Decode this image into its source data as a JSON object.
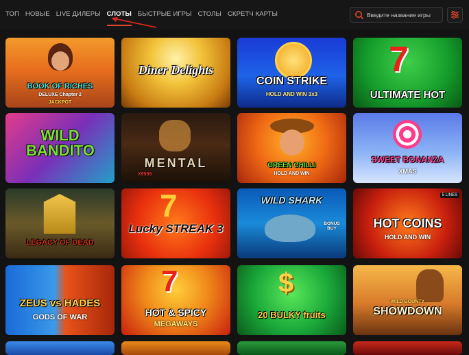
{
  "nav": {
    "tabs": [
      {
        "label": "ТОП"
      },
      {
        "label": "НОВЫЕ"
      },
      {
        "label": "LIVE ДИЛЕРЫ"
      },
      {
        "label": "СЛОТЫ"
      },
      {
        "label": "БЫСТРЫЕ ИГРЫ"
      },
      {
        "label": "СТОЛЫ"
      },
      {
        "label": "СКРЕТЧ КАРТЫ"
      }
    ],
    "active_tab": "СЛОТЫ"
  },
  "search": {
    "placeholder": "Введите название игры",
    "icon": "search-icon"
  },
  "filter": {
    "icon": "sliders-icon"
  },
  "accent": "#e8462a",
  "games": [
    {
      "title": "BOOK OF RICHES",
      "subtitle": "DELUXE Chapter 2",
      "extra": "JACKPOT"
    },
    {
      "title": "Diner Delights",
      "subtitle": ""
    },
    {
      "title": "COIN STRIKE",
      "subtitle": "HOLD AND WIN 3x3"
    },
    {
      "title": "ULTIMATE HOT",
      "subtitle": ""
    },
    {
      "title": "WILD BANDITO",
      "subtitle": ""
    },
    {
      "title": "MENTAL",
      "subtitle": "X9999"
    },
    {
      "title": "GREEN CHILLI",
      "subtitle": "HOLD AND WIN"
    },
    {
      "title": "SWEET BONANZA",
      "subtitle": "XMAS"
    },
    {
      "title": "LEGACY OF DEAD",
      "subtitle": ""
    },
    {
      "title": "Lucky STREAK 3",
      "subtitle": ""
    },
    {
      "title": "WILD SHARK",
      "subtitle": "BONUS BUY"
    },
    {
      "title": "HOT COINS",
      "subtitle": "HOLD AND WIN",
      "badge": "5 LINES"
    },
    {
      "title": "ZEUS vs HADES",
      "subtitle": "GODS OF WAR"
    },
    {
      "title": "HOT & SPICY",
      "subtitle": "MEGAWAYS"
    },
    {
      "title": "20 BULKY fruits",
      "subtitle": ""
    },
    {
      "title": "SHOWDOWN",
      "subtitle": "WILD BOUNTY"
    }
  ]
}
